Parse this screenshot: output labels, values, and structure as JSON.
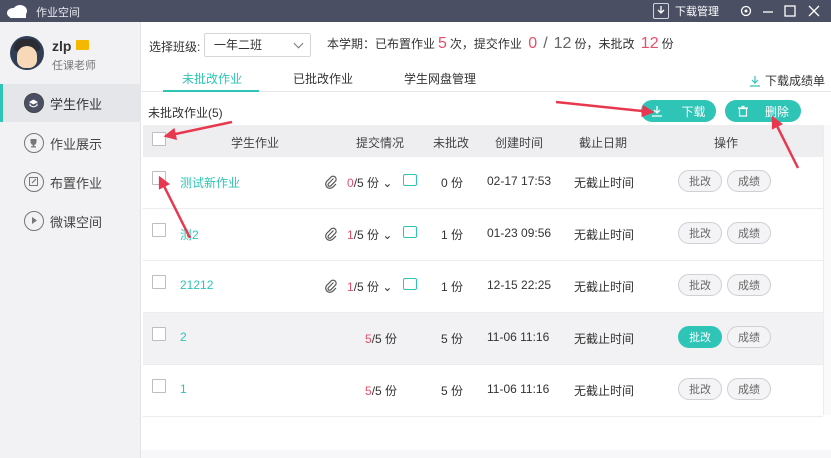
{
  "window": {
    "title": "作业空间",
    "download_manager": "下载管理"
  },
  "user": {
    "name": "zlp",
    "role": "任课老师"
  },
  "sidebar": {
    "items": [
      {
        "label": "学生作业",
        "icon": "student-homework-icon",
        "active": true
      },
      {
        "label": "作业展示",
        "icon": "trophy-icon",
        "active": false
      },
      {
        "label": "布置作业",
        "icon": "edit-icon",
        "active": false
      },
      {
        "label": "微课空间",
        "icon": "play-icon",
        "active": false
      }
    ]
  },
  "toolbar": {
    "class_label": "选择班级:",
    "class_value": "一年二班",
    "summary_prefix": "本学期：已布置作业",
    "assigned": "5",
    "summary_mid1": "次，提交作业",
    "submitted": "0",
    "slash": "/",
    "total": "12",
    "summary_mid2": "份，未批改",
    "uncorrected": "12",
    "summary_suffix": "份"
  },
  "tabs": {
    "items": [
      "未批改作业",
      "已批改作业",
      "学生网盘管理"
    ],
    "active_index": 0,
    "download_report": "下载成绩单"
  },
  "list": {
    "title": "未批改作业(5)",
    "download_label": "下载",
    "delete_label": "删除"
  },
  "table": {
    "headers": {
      "homework": "学生作业",
      "submission": "提交情况",
      "uncorrected": "未批改",
      "created": "创建时间",
      "deadline": "截止日期",
      "actions": "操作"
    },
    "rows": [
      {
        "name": "测试新作业",
        "submitted": "0",
        "total_text": "/5 份",
        "has_attach": true,
        "uncorrected": "0 份",
        "created": "02-17 17:53",
        "deadline": "无截止时间",
        "correct_label": "批改",
        "score_label": "成绩",
        "highlight": false
      },
      {
        "name": "测2",
        "submitted": "1",
        "total_text": "/5 份",
        "has_attach": true,
        "uncorrected": "1 份",
        "created": "01-23 09:56",
        "deadline": "无截止时间",
        "correct_label": "批改",
        "score_label": "成绩",
        "highlight": false
      },
      {
        "name": "21212",
        "submitted": "1",
        "total_text": "/5 份",
        "has_attach": true,
        "uncorrected": "1 份",
        "created": "12-15 22:25",
        "deadline": "无截止时间",
        "correct_label": "批改",
        "score_label": "成绩",
        "highlight": false
      },
      {
        "name": "2",
        "submitted": "5",
        "total_text": "/5 份",
        "has_attach": false,
        "uncorrected": "5 份",
        "created": "11-06 11:16",
        "deadline": "无截止时间",
        "correct_label": "批改",
        "score_label": "成绩",
        "highlight": true
      },
      {
        "name": "1",
        "submitted": "5",
        "total_text": "/5 份",
        "has_attach": false,
        "uncorrected": "5 份",
        "created": "11-06 11:16",
        "deadline": "无截止时间",
        "correct_label": "批改",
        "score_label": "成绩",
        "highlight": false
      }
    ]
  },
  "colors": {
    "accent": "#2ec4b6",
    "highlight_number": "#e5506a",
    "titlebar": "#4a4f63",
    "annotation_arrow": "#e8384f"
  }
}
